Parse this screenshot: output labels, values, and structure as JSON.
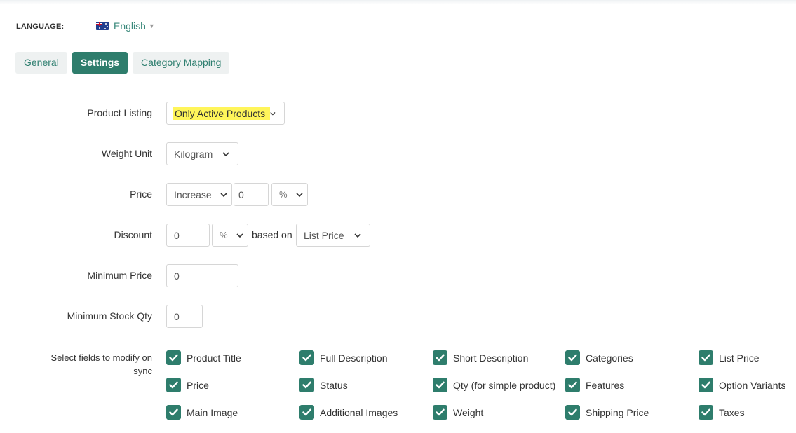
{
  "language": {
    "label": "LANGUAGE:",
    "selected": "English",
    "flag_icon": "australia-flag-icon"
  },
  "tabs": [
    {
      "label": "General",
      "active": false
    },
    {
      "label": "Settings",
      "active": true
    },
    {
      "label": "Category Mapping",
      "active": false
    }
  ],
  "form": {
    "product_listing": {
      "label": "Product Listing",
      "value": "Only Active Products"
    },
    "weight_unit": {
      "label": "Weight Unit",
      "value": "Kilogram"
    },
    "price": {
      "label": "Price",
      "mode": "Increase",
      "amount": "0",
      "unit": "%"
    },
    "discount": {
      "label": "Discount",
      "amount": "0",
      "unit": "%",
      "based_on_text": "based on",
      "based_on": "List Price"
    },
    "minimum_price": {
      "label": "Minimum Price",
      "value": "0"
    },
    "minimum_stock_qty": {
      "label": "Minimum Stock Qty",
      "value": "0"
    }
  },
  "sync": {
    "label_line1": "Select fields to modify on",
    "label_line2": "sync",
    "fields": [
      {
        "label": "Product Title",
        "checked": true
      },
      {
        "label": "Full Description",
        "checked": true
      },
      {
        "label": "Short Description",
        "checked": true
      },
      {
        "label": "Categories",
        "checked": true
      },
      {
        "label": "List Price",
        "checked": true
      },
      {
        "label": "Price",
        "checked": true
      },
      {
        "label": "Status",
        "checked": true
      },
      {
        "label": "Qty (for simple product)",
        "checked": true
      },
      {
        "label": "Features",
        "checked": true
      },
      {
        "label": "Option Variants",
        "checked": true
      },
      {
        "label": "Main Image",
        "checked": true
      },
      {
        "label": "Additional Images",
        "checked": true
      },
      {
        "label": "Weight",
        "checked": true
      },
      {
        "label": "Shipping Price",
        "checked": true
      },
      {
        "label": "Taxes",
        "checked": true
      }
    ]
  },
  "colors": {
    "accent": "#2e7d6c",
    "highlight": "#fff55a",
    "link": "#3b8a7c"
  }
}
